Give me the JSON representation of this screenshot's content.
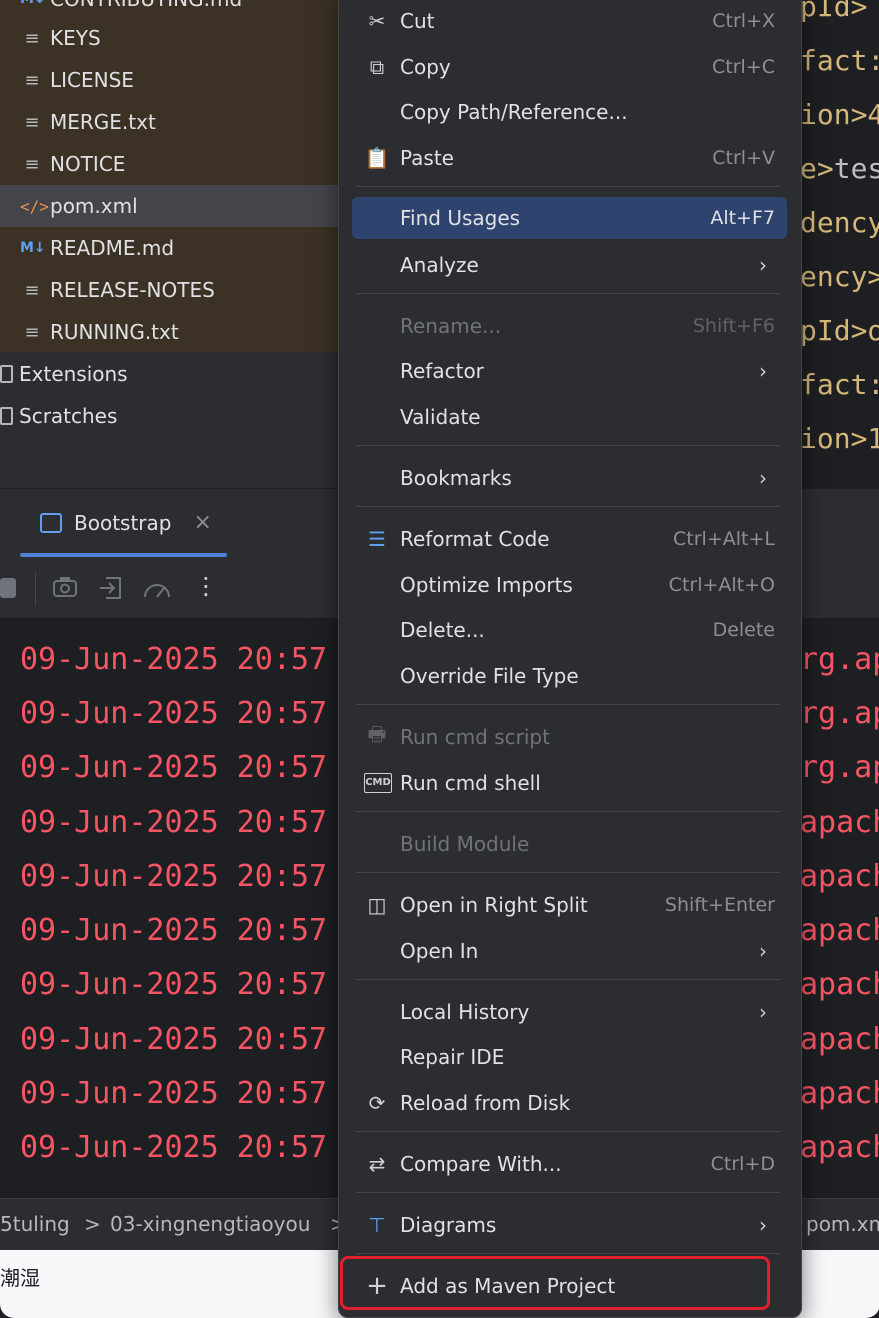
{
  "project_tree": {
    "files": [
      {
        "name": "CONTRIBUTING.md",
        "icon": "markdown-icon"
      },
      {
        "name": "KEYS",
        "icon": "text-file-icon"
      },
      {
        "name": "LICENSE",
        "icon": "text-file-icon"
      },
      {
        "name": "MERGE.txt",
        "icon": "text-file-icon"
      },
      {
        "name": "NOTICE",
        "icon": "text-file-icon"
      },
      {
        "name": "pom.xml",
        "icon": "xml-file-icon"
      },
      {
        "name": "README.md",
        "icon": "markdown-icon"
      },
      {
        "name": "RELEASE-NOTES",
        "icon": "text-file-icon"
      },
      {
        "name": "RUNNING.txt",
        "icon": "text-file-icon"
      }
    ],
    "folders": [
      "Extensions",
      "Scratches"
    ],
    "md_badge": "M↓",
    "xml_badge": "</>"
  },
  "editor": {
    "lines": [
      {
        "tag": "pId>",
        "text": ""
      },
      {
        "tag": "fact:",
        "text": ""
      },
      {
        "tag": "ion>4",
        "text": ""
      },
      {
        "tag": "e>",
        "text": "tes"
      },
      {
        "tag": "dency",
        "text": ""
      },
      {
        "tag": "ency>",
        "text": ""
      },
      {
        "tag": "pId>o",
        "text": ""
      },
      {
        "tag": "fact:",
        "text": ""
      },
      {
        "tag": "ion>1",
        "text": ""
      }
    ]
  },
  "run_window": {
    "tab_label": "Bootstrap",
    "close_glyph": "×",
    "toolbar_icons": [
      "stop-icon",
      "camera-icon",
      "import-icon",
      "gauge-icon",
      "more-icon"
    ],
    "more_glyph": "⋮",
    "log_prefix": "09-Jun-2025 20:57",
    "log_lines_right": [
      "rg.ap",
      "rg.ap",
      "rg.ap",
      "apach",
      "apach",
      "apach",
      "apach",
      "apach",
      "apach",
      "apach"
    ]
  },
  "breadcrumbs": {
    "items": [
      "5tuling",
      "03-xingnengtiaoyou",
      "pom.xml"
    ],
    "separator": ">"
  },
  "status_text": "潮湿",
  "context_menu": {
    "items": [
      {
        "label": "Cut",
        "shortcut": "Ctrl+X",
        "icon": "scissors-icon",
        "glyph": "✂"
      },
      {
        "label": "Copy",
        "shortcut": "Ctrl+C",
        "icon": "copy-icon",
        "glyph": "⧉"
      },
      {
        "label": "Copy Path/Reference...",
        "shortcut": ""
      },
      {
        "label": "Paste",
        "shortcut": "Ctrl+V",
        "icon": "clipboard-icon",
        "glyph": "📋"
      },
      {
        "label": "Find Usages",
        "shortcut": "Alt+F7",
        "highlighted": true
      },
      {
        "label": "Analyze",
        "submenu": true
      },
      {
        "label": "Rename...",
        "shortcut": "Shift+F6",
        "disabled": true
      },
      {
        "label": "Refactor",
        "submenu": true
      },
      {
        "label": "Validate"
      },
      {
        "label": "Bookmarks",
        "submenu": true
      },
      {
        "label": "Reformat Code",
        "shortcut": "Ctrl+Alt+L",
        "icon": "reformat-icon",
        "glyph": "☰"
      },
      {
        "label": "Optimize Imports",
        "shortcut": "Ctrl+Alt+O"
      },
      {
        "label": "Delete...",
        "shortcut": "Delete"
      },
      {
        "label": "Override File Type"
      },
      {
        "label": "Run cmd script",
        "disabled": true,
        "icon": "printer-icon",
        "glyph": "🖶"
      },
      {
        "label": "Run cmd shell",
        "icon": "cmd-icon",
        "glyph": "CMD"
      },
      {
        "label": "Build Module",
        "disabled": true
      },
      {
        "label": "Open in Right Split",
        "shortcut": "Shift+Enter",
        "icon": "split-icon",
        "glyph": "◫"
      },
      {
        "label": "Open In",
        "submenu": true
      },
      {
        "label": "Local History",
        "submenu": true
      },
      {
        "label": "Repair IDE"
      },
      {
        "label": "Reload from Disk",
        "icon": "reload-icon",
        "glyph": "⟳"
      },
      {
        "label": "Compare With...",
        "shortcut": "Ctrl+D",
        "icon": "compare-icon",
        "glyph": "⇄"
      },
      {
        "label": "Diagrams",
        "submenu": true,
        "icon": "diagram-icon",
        "glyph": "⊤"
      },
      {
        "label": "Add as Maven Project",
        "icon": "plus-icon",
        "glyph": "+",
        "emphasized": true
      }
    ],
    "submenu_glyph": "›"
  },
  "colors": {
    "highlight": "#2e436e",
    "emphasis_outline": "#e0202e",
    "log_error": "#f75464"
  }
}
